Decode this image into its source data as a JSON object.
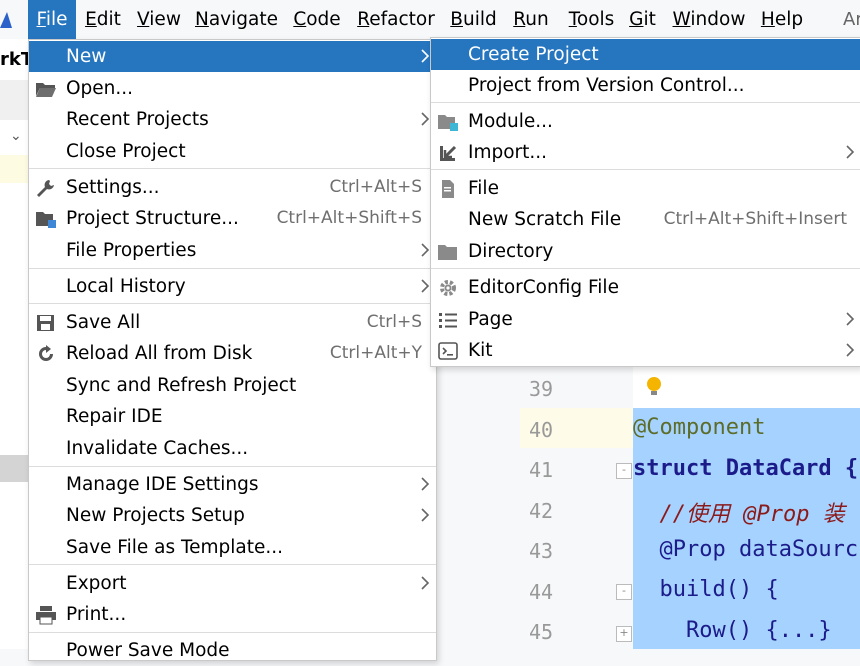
{
  "menubar": {
    "items": [
      {
        "label": "File",
        "u": "F",
        "rest": "ile",
        "active": true
      },
      {
        "label": "Edit",
        "u": "E",
        "rest": "dit"
      },
      {
        "label": "View",
        "u": "V",
        "rest": "iew"
      },
      {
        "label": "Navigate",
        "u": "N",
        "rest": "avigate"
      },
      {
        "label": "Code",
        "u": "C",
        "rest": "ode"
      },
      {
        "label": "Refactor",
        "u": "R",
        "rest": "efactor"
      },
      {
        "label": "Build",
        "u": "B",
        "rest": "uild"
      },
      {
        "label": "Run",
        "u": "R",
        "rest": "un"
      },
      {
        "label": "Tools",
        "u": "T",
        "rest": "ools"
      },
      {
        "label": "Git",
        "u": "G",
        "rest": "it"
      },
      {
        "label": "Window",
        "u": "W",
        "rest": "indow"
      },
      {
        "label": "Help",
        "u": "H",
        "rest": "elp"
      }
    ],
    "right_text": "Ar"
  },
  "background": {
    "tab_text": "rkT",
    "line_numbers": [
      "39",
      "40",
      "41",
      "42",
      "43",
      "44",
      "45"
    ],
    "code_lines": [
      {
        "text": "@Component"
      },
      {
        "text": "struct DataCard {"
      },
      {
        "text": "  //使用 @Prop 装"
      },
      {
        "text": "  @Prop dataSourc"
      },
      {
        "text": "  build() {"
      },
      {
        "text": "    Row() {...}"
      }
    ]
  },
  "file_menu": {
    "items": [
      {
        "label": "New",
        "submenu": true,
        "highlight": true
      },
      {
        "label": "Open...",
        "icon": "folder-open-icon"
      },
      {
        "label": "Recent Projects",
        "submenu": true
      },
      {
        "label": "Close Project"
      },
      {
        "label": "Settings...",
        "shortcut": "Ctrl+Alt+S",
        "icon": "wrench-icon"
      },
      {
        "label": "Project Structure...",
        "shortcut": "Ctrl+Alt+Shift+S",
        "icon": "project-structure-icon"
      },
      {
        "label": "File Properties",
        "submenu": true
      },
      {
        "label": "Local History",
        "submenu": true
      },
      {
        "label": "Save All",
        "shortcut": "Ctrl+S",
        "icon": "save-icon"
      },
      {
        "label": "Reload All from Disk",
        "shortcut": "Ctrl+Alt+Y",
        "icon": "reload-icon"
      },
      {
        "label": "Sync and Refresh Project"
      },
      {
        "label": "Repair IDE"
      },
      {
        "label": "Invalidate Caches..."
      },
      {
        "label": "Manage IDE Settings",
        "submenu": true
      },
      {
        "label": "New Projects Setup",
        "submenu": true
      },
      {
        "label": "Save File as Template..."
      },
      {
        "label": "Export",
        "submenu": true
      },
      {
        "label": "Print...",
        "icon": "printer-icon"
      },
      {
        "label": "Power Save Mode"
      }
    ]
  },
  "new_submenu": {
    "items": [
      {
        "label": "Create Project",
        "highlight": true
      },
      {
        "label": "Project from Version Control..."
      },
      {
        "label": "Module...",
        "icon": "module-icon"
      },
      {
        "label": "Import...",
        "submenu": true,
        "icon": "import-icon"
      },
      {
        "label": "File",
        "icon": "file-icon"
      },
      {
        "label": "New Scratch File",
        "shortcut": "Ctrl+Alt+Shift+Insert"
      },
      {
        "label": "Directory",
        "icon": "folder-icon"
      },
      {
        "label": "EditorConfig File",
        "icon": "gear-icon"
      },
      {
        "label": "Page",
        "submenu": true,
        "icon": "list-icon"
      },
      {
        "label": "Kit",
        "submenu": true,
        "icon": "kit-icon"
      }
    ]
  },
  "colors": {
    "accent": "#2675bf",
    "selection": "#a6d2ff"
  }
}
